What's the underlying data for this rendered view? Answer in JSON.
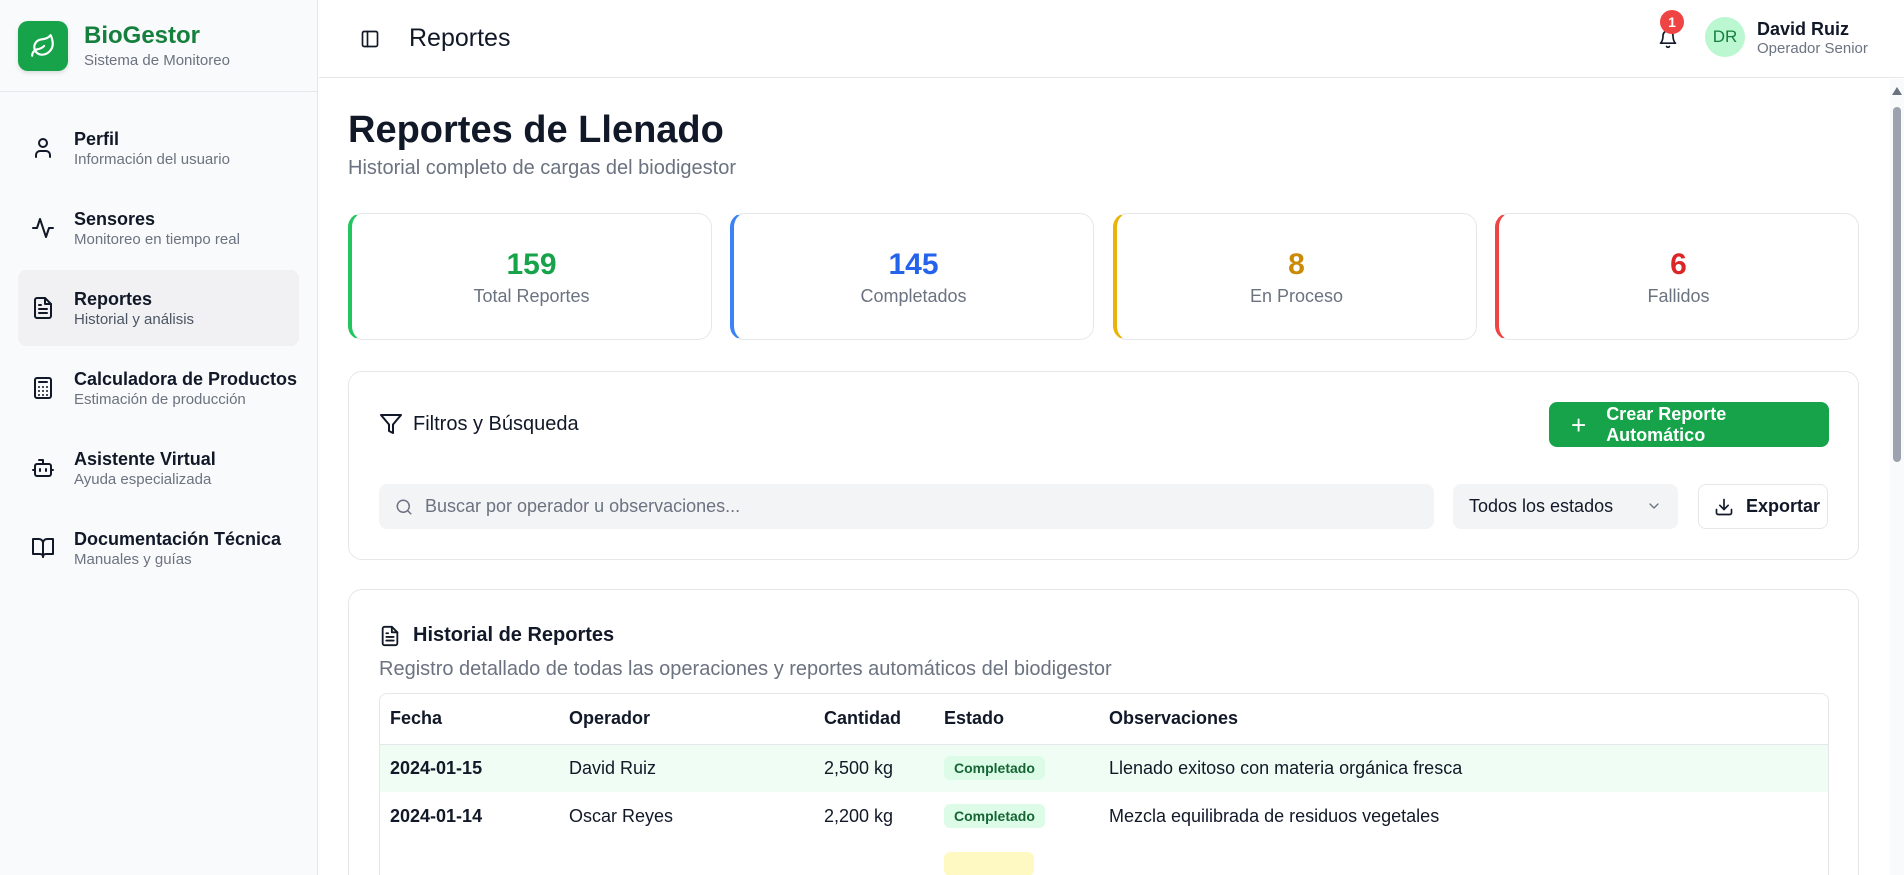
{
  "brand": {
    "name": "BioGestor",
    "subtitle": "Sistema de Monitoreo",
    "logo_icon": "leaf-icon"
  },
  "sidebar": {
    "items": [
      {
        "title": "Perfil",
        "subtitle": "Información del usuario",
        "icon": "user-icon",
        "active": false
      },
      {
        "title": "Sensores",
        "subtitle": "Monitoreo en tiempo real",
        "icon": "activity-icon",
        "active": false
      },
      {
        "title": "Reportes",
        "subtitle": "Historial y análisis",
        "icon": "file-text-icon",
        "active": true
      },
      {
        "title": "Calculadora de Productos",
        "subtitle": "Estimación de producción",
        "icon": "calculator-icon",
        "active": false
      },
      {
        "title": "Asistente Virtual",
        "subtitle": "Ayuda especializada",
        "icon": "bot-icon",
        "active": false
      },
      {
        "title": "Documentación Técnica",
        "subtitle": "Manuales y guías",
        "icon": "book-icon",
        "active": false
      }
    ]
  },
  "header": {
    "title": "Reportes",
    "notifications": "1",
    "user": {
      "initials": "DR",
      "name": "David Ruiz",
      "role": "Operador Senior"
    }
  },
  "page": {
    "title": "Reportes de Llenado",
    "subtitle": "Historial completo de cargas del biodigestor"
  },
  "stats": [
    {
      "value": "159",
      "label": "Total Reportes",
      "color": "#16a34a"
    },
    {
      "value": "145",
      "label": "Completados",
      "color": "#2563eb"
    },
    {
      "value": "8",
      "label": "En Proceso",
      "color": "#ca8a04"
    },
    {
      "value": "6",
      "label": "Fallidos",
      "color": "#dc2626"
    }
  ],
  "filters": {
    "title": "Filtros y Búsqueda",
    "create_label": "Crear Reporte Automático",
    "search_placeholder": "Buscar por operador u observaciones...",
    "status_selected": "Todos los estados",
    "export_label": "Exportar"
  },
  "history": {
    "title": "Historial de Reportes",
    "subtitle": "Registro detallado de todas las operaciones y reportes automáticos del biodigestor",
    "columns": [
      "Fecha",
      "Operador",
      "Cantidad",
      "Estado",
      "Observaciones"
    ],
    "rows": [
      {
        "fecha": "2024-01-15",
        "operador": "David Ruiz",
        "cantidad": "2,500 kg",
        "estado": "Completado",
        "observaciones": "Llenado exitoso con materia orgánica fresca"
      },
      {
        "fecha": "2024-01-14",
        "operador": "Oscar Reyes",
        "cantidad": "2,200 kg",
        "estado": "Completado",
        "observaciones": "Mezcla equilibrada de residuos vegetales"
      }
    ]
  },
  "colors": {
    "accent": "#16a34a",
    "badge": "#ef4444"
  }
}
